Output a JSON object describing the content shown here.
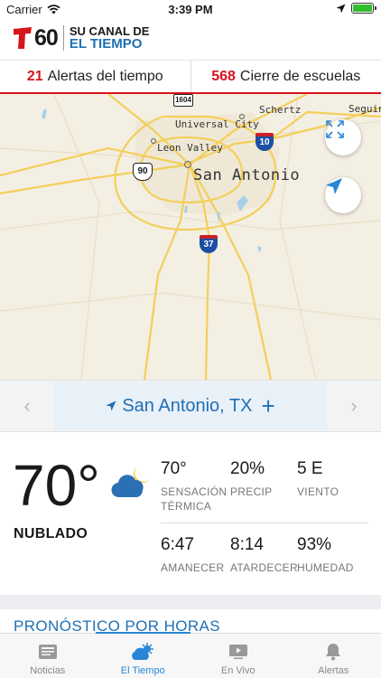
{
  "status_bar": {
    "carrier": "Carrier",
    "time": "3:39 PM"
  },
  "header": {
    "logo_number": "60",
    "tagline_line1": "SU CANAL DE",
    "tagline_line2": "EL TIEMPO",
    "brand_color": "#d8141b",
    "accent_color": "#1f6fb3"
  },
  "alerts_bar": {
    "weather_alerts_count": "21",
    "weather_alerts_label": "Alertas del tiempo",
    "school_closures_count": "568",
    "school_closures_label": "Cierre de escuelas"
  },
  "map": {
    "city_label": "San Antonio",
    "places": [
      "Schertz",
      "Universal City",
      "Leon Valley",
      "Seguin"
    ],
    "shields": [
      "1604",
      "10",
      "90",
      "37"
    ]
  },
  "location": {
    "name": "San Antonio, TX",
    "add_symbol": "+",
    "prev_symbol": "‹",
    "next_symbol": "›"
  },
  "current": {
    "temperature": "70°",
    "condition": "NUBLADO",
    "feels_like": {
      "value": "70°",
      "label_line1": "SENSACIÓN",
      "label_line2": "TÉRMICA"
    },
    "precip": {
      "value": "20%",
      "label": "PRECIP"
    },
    "wind": {
      "value": "5 E",
      "label": "VIENTO"
    },
    "sunrise": {
      "value": "6:47",
      "label": "AMANECER"
    },
    "sunset": {
      "value": "8:14",
      "label": "ATARDECER"
    },
    "humidity": {
      "value": "93%",
      "label": "HUMEDAD"
    }
  },
  "hourly": {
    "title": "PRONÓSTICO POR HORAS"
  },
  "tabs": [
    {
      "label": "Noticias",
      "icon": "news-icon"
    },
    {
      "label": "El Tiempo",
      "icon": "weather-icon",
      "active": true
    },
    {
      "label": "En Vivo",
      "icon": "live-tv-icon"
    },
    {
      "label": "Alertas",
      "icon": "bell-icon"
    }
  ]
}
